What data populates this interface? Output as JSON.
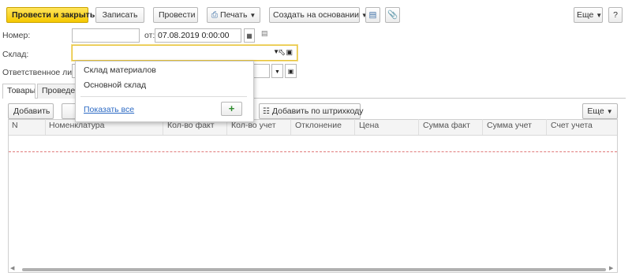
{
  "toolbar": {
    "post_close": "Провести и закрыть",
    "save": "Записать",
    "post": "Провести",
    "print": "Печать",
    "create_based": "Создать на основании",
    "more": "Еще",
    "help": "?"
  },
  "form": {
    "number_label": "Номер:",
    "number_value": "",
    "from_label": "от:",
    "date_value": "07.08.2019  0:00:00",
    "warehouse_label": "Склад:",
    "warehouse_value": "",
    "responsible_label": "Ответственное лицо:"
  },
  "dropdown": {
    "items": [
      "Склад материалов",
      "Основной склад"
    ],
    "show_all": "Показать все",
    "add_glyph": "+"
  },
  "tabs": [
    "Товары",
    "Проведение"
  ],
  "table_toolbar": {
    "add": "Добавить",
    "add_barcode": "Добавить по штрихкоду",
    "more": "Еще"
  },
  "table": {
    "columns": [
      "N",
      "Номенклатура",
      "Кол-во факт",
      "Кол-во учет",
      "Отклонение",
      "Цена",
      "Сумма факт",
      "Сумма учет",
      "Счет учета"
    ]
  },
  "colors": {
    "primary_button": "#f5c800",
    "link": "#2c6ac4",
    "add_icon": "#2e8b2e",
    "active_border": "#e8c43a"
  }
}
